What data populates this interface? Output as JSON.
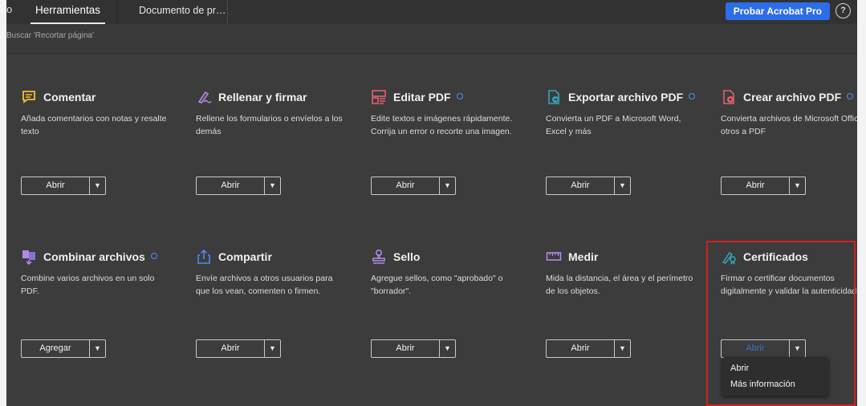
{
  "header": {
    "partial_tab": "o",
    "tabs": [
      {
        "label": "Herramientas",
        "active": true
      },
      {
        "label": "Documento de pr…",
        "active": false
      }
    ],
    "try_button": "Probar Acrobat Pro",
    "help_icon": "help-circle-icon",
    "accent": "#2c6de9"
  },
  "search": {
    "placeholder": "Buscar 'Recortar página'"
  },
  "tools": [
    {
      "title": "Comentar",
      "icon": "comment-icon",
      "new": false,
      "desc": "Añada comentarios con notas y resalte texto",
      "button": "Abrir"
    },
    {
      "title": "Rellenar y firmar",
      "icon": "fill-sign-icon",
      "new": false,
      "desc": "Rellene los formularios o envíelos a los demás",
      "button": "Abrir"
    },
    {
      "title": "Editar PDF",
      "icon": "edit-pdf-icon",
      "new": true,
      "desc": "Edite textos e imágenes rápidamente. Corrija un error o recorte una imagen.",
      "button": "Abrir"
    },
    {
      "title": "Exportar archivo PDF",
      "icon": "export-pdf-icon",
      "new": true,
      "desc": "Convierta un PDF a Microsoft Word, Excel y más",
      "button": "Abrir"
    },
    {
      "title": "Crear archivo PDF",
      "icon": "create-pdf-icon",
      "new": true,
      "desc": "Convierta archivos de Microsoft Office y otros a PDF",
      "button": "Abrir"
    },
    {
      "title": "Combinar archivos",
      "icon": "combine-files-icon",
      "new": true,
      "desc": "Combine varios archivos en un solo PDF.",
      "button": "Agregar"
    },
    {
      "title": "Compartir",
      "icon": "share-icon",
      "new": false,
      "desc": "Envíe archivos a otros usuarios para que los vean, comenten o firmen.",
      "button": "Abrir"
    },
    {
      "title": "Sello",
      "icon": "stamp-icon",
      "new": false,
      "desc": "Agregue sellos, como \"aprobado\" o \"borrador\".",
      "button": "Abrir"
    },
    {
      "title": "Medir",
      "icon": "ruler-icon",
      "new": false,
      "desc": "Mida la distancia, el área y el perímetro de los objetos.",
      "button": "Abrir"
    },
    {
      "title": "Certificados",
      "icon": "certificate-icon",
      "new": false,
      "desc": "Firmar o certificar documentos digitalmente y validar la autenticidad.",
      "button": "Abrir"
    }
  ],
  "dropdown": {
    "items": [
      "Abrir",
      "Más información"
    ]
  },
  "colors": {
    "comment": "#f2c12e",
    "purple": "#b08ae6",
    "pink": "#e4606c",
    "teal": "#34a6b8",
    "blue": "#4c8bf5"
  }
}
